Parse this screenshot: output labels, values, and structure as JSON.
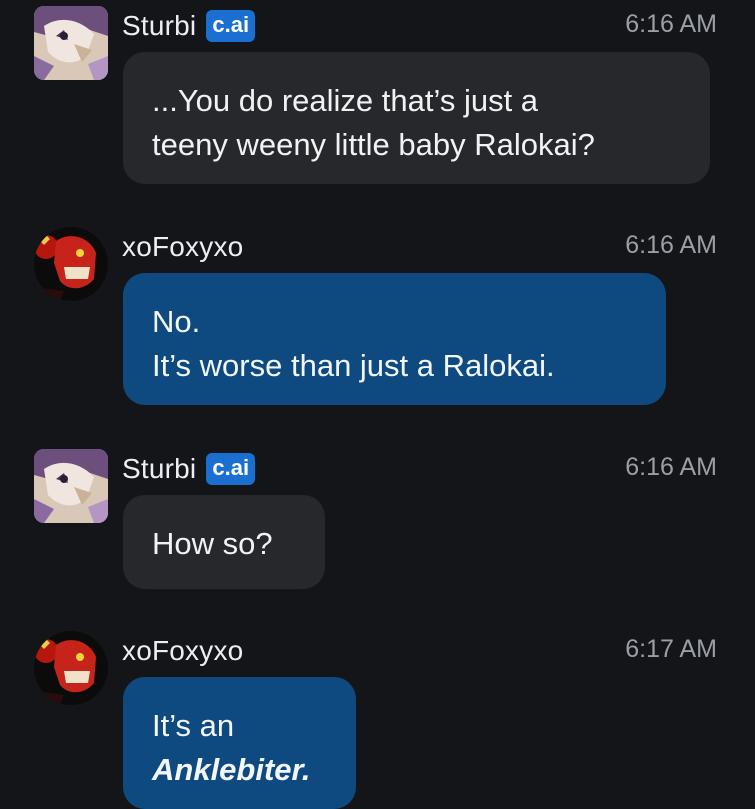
{
  "messages": [
    {
      "username": "Sturbi",
      "badge": "c.ai",
      "time": "6:16 AM",
      "role": "bot",
      "lines": [
        "...You do realize that’s just a",
        "teeny weeny little baby Ralokai?"
      ]
    },
    {
      "username": "xoFoxyxo",
      "time": "6:16 AM",
      "role": "user",
      "lines": [
        "No.",
        "It’s worse than just a Ralokai."
      ]
    },
    {
      "username": "Sturbi",
      "badge": "c.ai",
      "time": "6:16 AM",
      "role": "bot",
      "lines": [
        "How so?"
      ]
    },
    {
      "username": "xoFoxyxo",
      "time": "6:17 AM",
      "role": "user",
      "lines": [
        "It’s an",
        "Anklebiter."
      ]
    }
  ],
  "colors": {
    "background": "#141518",
    "bot_bubble": "#27282c",
    "user_bubble": "#0e4a80",
    "badge": "#1a6fd1",
    "timestamp": "#9a9fa7"
  },
  "icons": {
    "bot_avatar": "character-avatar-icon",
    "user_avatar": "user-avatar-icon"
  }
}
